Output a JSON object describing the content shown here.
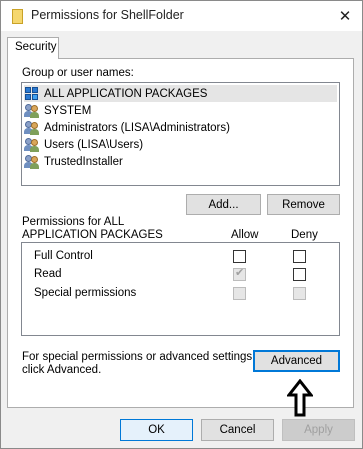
{
  "window": {
    "title": "Permissions for ShellFolder"
  },
  "tabs": [
    {
      "label": "Security"
    }
  ],
  "security": {
    "group_label": "Group or user names:",
    "users": [
      {
        "name": "ALL APPLICATION PACKAGES",
        "icon": "package-icon",
        "selected": true
      },
      {
        "name": "SYSTEM",
        "icon": "users-icon"
      },
      {
        "name": "Administrators (LISA\\Administrators)",
        "icon": "users-icon"
      },
      {
        "name": "Users (LISA\\Users)",
        "icon": "users-icon"
      },
      {
        "name": "TrustedInstaller",
        "icon": "users-icon"
      }
    ],
    "add_label": "Add...",
    "remove_label": "Remove",
    "permissions_for_line1": "Permissions for ALL",
    "permissions_for_line2": "APPLICATION PACKAGES",
    "allow_header": "Allow",
    "deny_header": "Deny",
    "permissions": [
      {
        "name": "Full Control",
        "allow": false,
        "deny": false,
        "allow_disabled": false,
        "deny_disabled": false
      },
      {
        "name": "Read",
        "allow": true,
        "deny": false,
        "allow_disabled": true,
        "deny_disabled": false
      },
      {
        "name": "Special permissions",
        "allow": false,
        "deny": false,
        "allow_disabled": true,
        "deny_disabled": true
      }
    ],
    "special_note_line1": "For special permissions or advanced settings,",
    "special_note_line2": "click Advanced.",
    "advanced_label": "Advanced"
  },
  "footer": {
    "ok_label": "OK",
    "cancel_label": "Cancel",
    "apply_label": "Apply"
  },
  "colors": {
    "accent": "#0078d7",
    "window_bg": "#f0f0f0"
  }
}
